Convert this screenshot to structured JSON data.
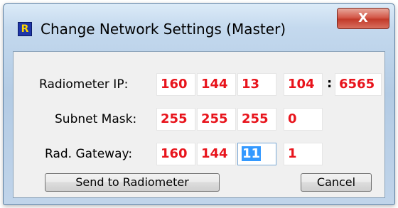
{
  "window": {
    "title": "Change Network Settings (Master)",
    "app_icon_glyph": "R",
    "close_glyph": "X"
  },
  "labels": {
    "radiometer_ip": "Radiometer  IP:",
    "subnet_mask": "Subnet Mask:",
    "rad_gateway": "Rad. Gateway:",
    "port_separator": ":"
  },
  "radiometer_ip": {
    "octets": [
      "160",
      "144",
      "13",
      "104"
    ],
    "port": "6565"
  },
  "subnet_mask": {
    "octets": [
      "255",
      "255",
      "255",
      "0"
    ]
  },
  "rad_gateway": {
    "octets": [
      "160",
      "144",
      "11",
      "1"
    ]
  },
  "buttons": {
    "send": "Send to Radiometer",
    "cancel": "Cancel"
  },
  "colors": {
    "value_red": "#e8141c",
    "selection_blue": "#3399ff",
    "close_red": "#c23a2a"
  }
}
